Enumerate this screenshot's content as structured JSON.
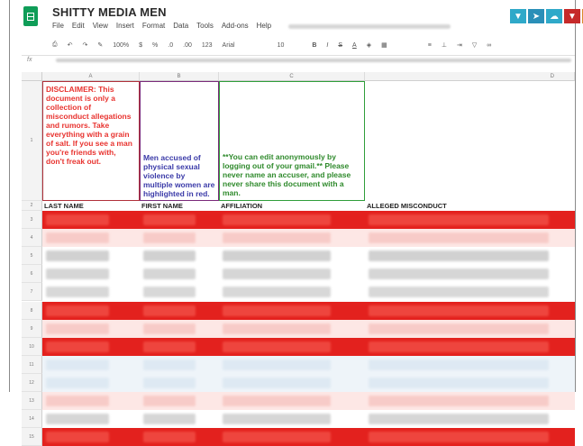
{
  "app": {
    "title": "SHITTY MEDIA MEN",
    "logo_icon": "sheets-logo-icon"
  },
  "menu": [
    "File",
    "Edit",
    "View",
    "Insert",
    "Format",
    "Data",
    "Tools",
    "Add-ons",
    "Help"
  ],
  "toolbar": {
    "zoom": "100%",
    "currency": "$",
    "percent": "%",
    "decimal_decrease": ".0",
    "decimal_increase": ".00",
    "number_format": "123",
    "font": "Arial",
    "font_size": "10",
    "bold": "B",
    "italic": "I",
    "strikethrough": "S",
    "text_color": "A"
  },
  "formula_bar": {
    "fx_label": "fx"
  },
  "grid": {
    "column_headers": [
      "A",
      "B",
      "C",
      "D"
    ],
    "row_numbers": [
      "1",
      "2",
      "3",
      "4",
      "5",
      "6",
      "7",
      "8",
      "9",
      "10",
      "11",
      "12",
      "13",
      "14",
      "15"
    ],
    "disclaimer": "DISCLAIMER: This document is only a collection of misconduct allegations and rumors. Take everything with a grain of salt. If you see a man you're friends with, don't freak out.",
    "red_note": "Men accused of physical sexual violence by multiple women are highlighted in red.",
    "anonymous_note": "**You can edit anonymously by logging out of your gmail.** Please never name an accuser, and please never share this document with a man.",
    "column_titles": [
      "LAST NAME",
      "FIRST NAME",
      "AFFILIATION",
      "ALLEGED MISCONDUCT"
    ]
  },
  "colors": {
    "red_highlight": "#e3211e",
    "light_red": "#f7c7c3",
    "light_blue": "#dce8f2",
    "disclaimer_text": "#e8332f",
    "note_text": "#3a3aa8",
    "anon_text": "#2f8a2c"
  }
}
